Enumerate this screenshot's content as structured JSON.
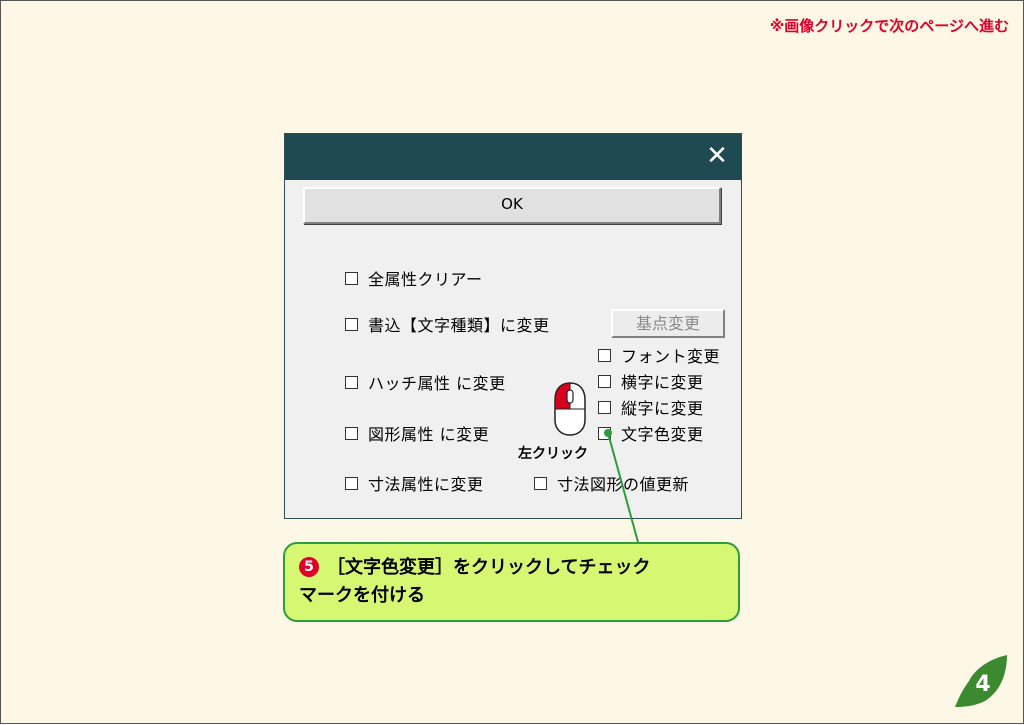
{
  "header": {
    "note": "※画像クリックで次のページへ進む"
  },
  "dialog": {
    "close_glyph": "✕",
    "ok_label": "OK",
    "checkboxes": {
      "all_clear": "全属性クリアー",
      "write_mode": "書込【文字種類】に変更",
      "hatch": "ハッチ属性 に変更",
      "figure": "図形属性 に変更",
      "dimension": "寸法属性に変更",
      "dim_figure_update": "寸法図形の値更新",
      "font_change": "フォント変更",
      "horizontal": "横字に変更",
      "vertical": "縦字に変更",
      "text_color": "文字色変更"
    },
    "basepoint_label": "基点変更"
  },
  "annotation": {
    "click_label": "左クリック",
    "step_number": "5",
    "instruction_line1": "［文字色変更］をクリックしてチェック",
    "instruction_line2": "マークを付ける"
  },
  "page": {
    "number": "4"
  },
  "colors": {
    "titlebar": "#204a52",
    "accent_red": "#e0002a",
    "callout_bg": "#d6f772",
    "callout_border": "#2e9b3c",
    "badge": "#3b8a2f"
  },
  "icons": {
    "mouse": "mouse-left-click-icon",
    "leaf": "leaf-icon",
    "close": "close-icon"
  }
}
